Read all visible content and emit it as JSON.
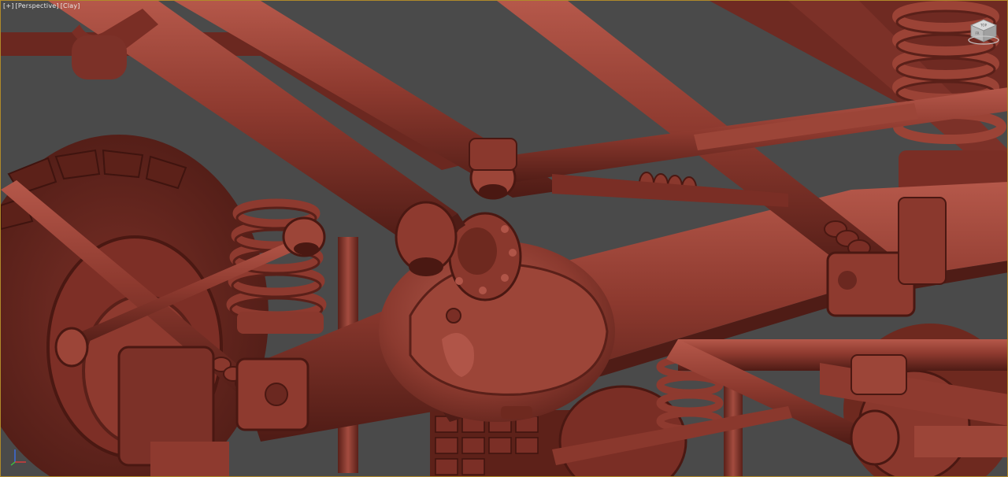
{
  "viewport": {
    "labels": {
      "plus": "[+]",
      "view": "[Perspective]",
      "shading": "[Clay]"
    },
    "viewcube": {
      "face_top": "TOP",
      "face_front": "FR"
    },
    "colors": {
      "background": "#4a4a4a",
      "clay": "#8e3a2f",
      "clay_dark": "#5a2019",
      "clay_light": "#b5584a",
      "border_active": "#b08a2a"
    },
    "icons": [
      "viewcube-icon",
      "axis-gizmo-icon"
    ]
  }
}
